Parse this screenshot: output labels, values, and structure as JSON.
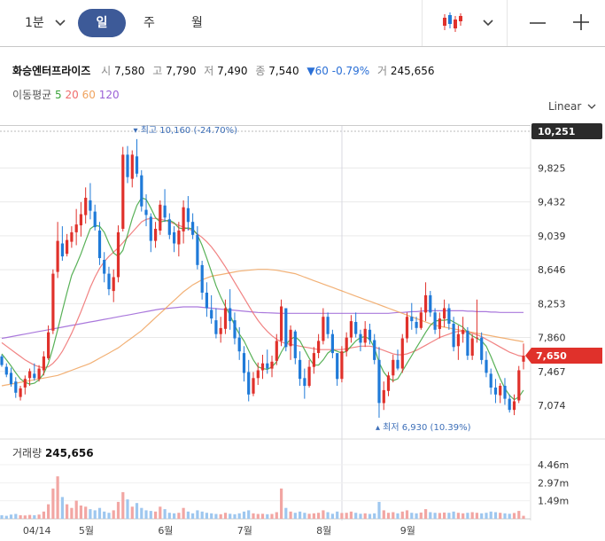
{
  "toolbar": {
    "interval": "1분",
    "tabs": [
      "일",
      "주",
      "월"
    ],
    "active_tab": "일"
  },
  "stock": {
    "name": "화승엔터프라이즈",
    "open_label": "시",
    "open": "7,580",
    "high_label": "고",
    "high": "7,790",
    "low_label": "저",
    "low": "7,490",
    "close_label": "종",
    "close": "7,540",
    "change": "▼60",
    "change_pct": "-0.79%",
    "volume_label": "거",
    "volume": "245,656"
  },
  "ma_legend": {
    "label": "이동평균",
    "periods": [
      "5",
      "20",
      "60",
      "120"
    ]
  },
  "scale_mode": "Linear",
  "volume_panel": {
    "label": "거래량",
    "value": "245,656"
  },
  "colors": {
    "up": "#e0312b",
    "down": "#1f7ad8",
    "ma5": "#3ba33a",
    "ma20": "#ef6c6c",
    "ma60": "#f0a35e",
    "ma120": "#9b61d6",
    "accent": "#3d5a98"
  },
  "chart_data": {
    "type": "candlestick",
    "y_ticks": [
      "9,825",
      "9,432",
      "9,039",
      "8,646",
      "8,253",
      "7,860",
      "7,467",
      "7,074"
    ],
    "y_tick_values": [
      9825,
      9432,
      9039,
      8646,
      8253,
      7860,
      7467,
      7074
    ],
    "x_labels": [
      "04/14",
      "5월",
      "6월",
      "7월",
      "8월",
      "9월"
    ],
    "high_marker": {
      "label": "최고",
      "value": "10,160",
      "pct": "(-24.70%)",
      "price": 10160
    },
    "low_marker": {
      "label": "최저",
      "value": "6,930",
      "pct": "(10.39%)",
      "price": 6930
    },
    "top_badge": "10,251",
    "top_badge_value": 10251,
    "last_badge": "7,650",
    "last_value": 7650,
    "volume_ticks": [
      "4.46m",
      "2.97m",
      "1.49m"
    ],
    "volume_tick_values": [
      4460000,
      2970000,
      1490000
    ],
    "candles": [
      [
        7660,
        7520,
        7640,
        7540,
        -1
      ],
      [
        7560,
        7400,
        7520,
        7430,
        -1
      ],
      [
        7510,
        7290,
        7450,
        7320,
        -1
      ],
      [
        7400,
        7160,
        7350,
        7220,
        -1
      ],
      [
        7300,
        7130,
        7170,
        7270,
        1
      ],
      [
        7420,
        7200,
        7280,
        7380,
        1
      ],
      [
        7500,
        7300,
        7390,
        7470,
        1
      ],
      [
        7560,
        7360,
        7440,
        7390,
        -1
      ],
      [
        7540,
        7350,
        7380,
        7500,
        1
      ],
      [
        7700,
        7420,
        7480,
        7640,
        1
      ],
      [
        8000,
        7600,
        7620,
        7920,
        1
      ],
      [
        8650,
        7900,
        7940,
        8600,
        1
      ],
      [
        9200,
        8550,
        8620,
        8980,
        1
      ],
      [
        9150,
        8750,
        8950,
        8800,
        -1
      ],
      [
        9060,
        8800,
        8830,
        8990,
        1
      ],
      [
        9150,
        8900,
        8970,
        9080,
        1
      ],
      [
        9350,
        8930,
        9080,
        9170,
        1
      ],
      [
        9430,
        9030,
        9160,
        9290,
        1
      ],
      [
        9600,
        9180,
        9280,
        9480,
        1
      ],
      [
        9650,
        9230,
        9450,
        9330,
        -1
      ],
      [
        9400,
        9100,
        9320,
        9140,
        -1
      ],
      [
        9200,
        8700,
        9100,
        8780,
        -1
      ],
      [
        8850,
        8500,
        8760,
        8600,
        -1
      ],
      [
        8680,
        8350,
        8600,
        8420,
        -1
      ],
      [
        8650,
        8270,
        8400,
        8560,
        1
      ],
      [
        9160,
        8500,
        8560,
        9080,
        1
      ],
      [
        10070,
        9090,
        9120,
        9980,
        1
      ],
      [
        10080,
        9650,
        9980,
        9720,
        -1
      ],
      [
        10030,
        9600,
        9700,
        9980,
        1
      ],
      [
        10160,
        9720,
        9960,
        9760,
        -1
      ],
      [
        9800,
        9320,
        9740,
        9380,
        -1
      ],
      [
        9520,
        9150,
        9340,
        9280,
        -1
      ],
      [
        9300,
        8850,
        9260,
        8980,
        -1
      ],
      [
        9200,
        8900,
        8980,
        9120,
        1
      ],
      [
        9450,
        9050,
        9100,
        9400,
        1
      ],
      [
        9580,
        9200,
        9390,
        9250,
        -1
      ],
      [
        9300,
        9000,
        9230,
        9050,
        -1
      ],
      [
        9150,
        8850,
        9080,
        8950,
        -1
      ],
      [
        9200,
        8800,
        8940,
        9100,
        1
      ],
      [
        9450,
        8950,
        9090,
        9370,
        1
      ],
      [
        9500,
        9100,
        9360,
        9200,
        -1
      ],
      [
        9300,
        9000,
        9200,
        9050,
        -1
      ],
      [
        9150,
        8650,
        9050,
        8700,
        -1
      ],
      [
        8750,
        8300,
        8700,
        8380,
        -1
      ],
      [
        8500,
        8100,
        8380,
        8200,
        -1
      ],
      [
        8350,
        8020,
        8180,
        8080,
        -1
      ],
      [
        8200,
        7850,
        8060,
        7900,
        -1
      ],
      [
        8100,
        7800,
        7900,
        7970,
        1
      ],
      [
        8300,
        7900,
        7960,
        8200,
        1
      ],
      [
        8420,
        7950,
        8200,
        8050,
        -1
      ],
      [
        8150,
        7780,
        8060,
        7850,
        -1
      ],
      [
        7980,
        7600,
        7860,
        7700,
        -1
      ],
      [
        7760,
        7350,
        7680,
        7450,
        -1
      ],
      [
        7600,
        7120,
        7460,
        7200,
        -1
      ],
      [
        7460,
        7180,
        7210,
        7390,
        1
      ],
      [
        7570,
        7310,
        7390,
        7480,
        1
      ],
      [
        7660,
        7380,
        7480,
        7560,
        1
      ],
      [
        7720,
        7440,
        7560,
        7500,
        -1
      ],
      [
        7650,
        7400,
        7500,
        7580,
        1
      ],
      [
        7900,
        7540,
        7590,
        7820,
        1
      ],
      [
        8300,
        7760,
        7820,
        8220,
        1
      ],
      [
        8150,
        7700,
        8200,
        7750,
        -1
      ],
      [
        8000,
        7600,
        7760,
        7950,
        1
      ],
      [
        7950,
        7550,
        7930,
        7620,
        -1
      ],
      [
        7700,
        7300,
        7600,
        7380,
        -1
      ],
      [
        7500,
        7150,
        7390,
        7300,
        -1
      ],
      [
        7600,
        7280,
        7300,
        7520,
        1
      ],
      [
        7750,
        7440,
        7520,
        7680,
        1
      ],
      [
        7900,
        7620,
        7680,
        7820,
        1
      ],
      [
        8200,
        7780,
        7820,
        8100,
        1
      ],
      [
        8150,
        7850,
        8100,
        7900,
        -1
      ],
      [
        7950,
        7620,
        7900,
        7680,
        -1
      ],
      [
        7650,
        7300,
        7680,
        7380,
        -1
      ],
      [
        7760,
        7340,
        7380,
        7700,
        1
      ],
      [
        7920,
        7640,
        7700,
        7860,
        1
      ],
      [
        8120,
        7800,
        7860,
        8050,
        1
      ],
      [
        8150,
        7860,
        8040,
        7900,
        -1
      ],
      [
        7950,
        7700,
        7900,
        7800,
        -1
      ],
      [
        8050,
        7750,
        7800,
        7960,
        1
      ],
      [
        8020,
        7780,
        7950,
        7830,
        -1
      ],
      [
        7900,
        7550,
        7830,
        7600,
        -1
      ],
      [
        7750,
        6930,
        7600,
        7100,
        -1
      ],
      [
        7350,
        7020,
        7100,
        7250,
        1
      ],
      [
        7460,
        7180,
        7240,
        7420,
        1
      ],
      [
        7660,
        7340,
        7420,
        7600,
        1
      ],
      [
        7720,
        7480,
        7600,
        7500,
        -1
      ],
      [
        7900,
        7450,
        7500,
        7850,
        1
      ],
      [
        8150,
        7800,
        7850,
        8100,
        1
      ],
      [
        8260,
        7950,
        8100,
        8050,
        -1
      ],
      [
        8100,
        7900,
        8040,
        7970,
        -1
      ],
      [
        8210,
        7950,
        7970,
        8150,
        1
      ],
      [
        8500,
        8050,
        8150,
        8350,
        1
      ],
      [
        8400,
        8100,
        8350,
        8150,
        -1
      ],
      [
        8200,
        7900,
        8150,
        7950,
        -1
      ],
      [
        8150,
        7850,
        7960,
        8080,
        1
      ],
      [
        8300,
        7980,
        8080,
        8200,
        1
      ],
      [
        8250,
        7950,
        8200,
        8020,
        -1
      ],
      [
        8100,
        7700,
        8020,
        7750,
        -1
      ],
      [
        8000,
        7600,
        7760,
        7900,
        1
      ],
      [
        8100,
        7800,
        7900,
        7950,
        1
      ],
      [
        7980,
        7600,
        7940,
        7650,
        -1
      ],
      [
        7900,
        7600,
        7650,
        7850,
        1
      ],
      [
        8300,
        7800,
        7850,
        7860,
        1
      ],
      [
        7920,
        7550,
        7860,
        7600,
        -1
      ],
      [
        7700,
        7400,
        7600,
        7450,
        -1
      ],
      [
        7500,
        7200,
        7440,
        7280,
        -1
      ],
      [
        7380,
        7100,
        7280,
        7200,
        -1
      ],
      [
        7330,
        7100,
        7190,
        7300,
        1
      ],
      [
        7390,
        7080,
        7300,
        7150,
        -1
      ],
      [
        7200,
        6990,
        7150,
        7020,
        -1
      ],
      [
        7200,
        6960,
        7020,
        7120,
        1
      ],
      [
        7530,
        7100,
        7130,
        7480,
        1
      ],
      [
        7790,
        7490,
        7580,
        7650,
        1
      ]
    ],
    "ma5": [
      7670,
      7600,
      7530,
      7450,
      7380,
      7340,
      7320,
      7330,
      7370,
      7440,
      7560,
      7740,
      7950,
      8170,
      8380,
      8580,
      8700,
      8830,
      8980,
      9120,
      9160,
      9150,
      9080,
      8950,
      8840,
      8800,
      8870,
      9050,
      9240,
      9390,
      9480,
      9460,
      9360,
      9250,
      9200,
      9210,
      9220,
      9190,
      9130,
      9120,
      9130,
      9120,
      9050,
      8930,
      8780,
      8620,
      8460,
      8330,
      8220,
      8120,
      8000,
      7900,
      7820,
      7710,
      7600,
      7520,
      7500,
      7490,
      7520,
      7580,
      7690,
      7780,
      7840,
      7870,
      7820,
      7720,
      7620,
      7540,
      7540,
      7600,
      7680,
      7720,
      7700,
      7680,
      7700,
      7760,
      7820,
      7860,
      7870,
      7840,
      7740,
      7570,
      7460,
      7390,
      7360,
      7380,
      7470,
      7560,
      7650,
      7740,
      7830,
      7920,
      8000,
      8050,
      8060,
      8060,
      8070,
      8040,
      8010,
      7980,
      7920,
      7880,
      7850,
      7820,
      7760,
      7640,
      7510,
      7380,
      7270,
      7190,
      7140,
      7170,
      7250
    ],
    "ma20": [
      7800,
      7760,
      7720,
      7680,
      7640,
      7600,
      7570,
      7540,
      7520,
      7510,
      7520,
      7560,
      7620,
      7700,
      7800,
      7910,
      8030,
      8160,
      8300,
      8440,
      8560,
      8660,
      8740,
      8800,
      8850,
      8900,
      8960,
      9020,
      9080,
      9140,
      9200,
      9230,
      9240,
      9240,
      9230,
      9220,
      9200,
      9180,
      9160,
      9140,
      9120,
      9100,
      9060,
      9020,
      8970,
      8910,
      8840,
      8760,
      8680,
      8590,
      8500,
      8410,
      8320,
      8230,
      8140,
      8060,
      7990,
      7930,
      7880,
      7840,
      7810,
      7790,
      7780,
      7770,
      7760,
      7750,
      7740,
      7730,
      7720,
      7720,
      7720,
      7720,
      7720,
      7720,
      7730,
      7740,
      7750,
      7760,
      7760,
      7760,
      7750,
      7730,
      7710,
      7690,
      7670,
      7660,
      7660,
      7670,
      7690,
      7710,
      7740,
      7770,
      7800,
      7830,
      7860,
      7880,
      7900,
      7920,
      7930,
      7930,
      7920,
      7910,
      7890,
      7870,
      7840,
      7810,
      7780,
      7750,
      7720,
      7690,
      7670,
      7650,
      7640
    ],
    "ma60": [
      7300,
      7310,
      7320,
      7330,
      7340,
      7350,
      7360,
      7370,
      7380,
      7390,
      7400,
      7410,
      7420,
      7440,
      7460,
      7480,
      7500,
      7520,
      7540,
      7560,
      7590,
      7620,
      7650,
      7680,
      7710,
      7740,
      7780,
      7820,
      7860,
      7900,
      7940,
      7990,
      8040,
      8090,
      8140,
      8190,
      8240,
      8290,
      8340,
      8390,
      8430,
      8470,
      8500,
      8530,
      8550,
      8570,
      8580,
      8590,
      8600,
      8610,
      8620,
      8630,
      8635,
      8640,
      8645,
      8650,
      8650,
      8650,
      8645,
      8640,
      8630,
      8620,
      8610,
      8600,
      8580,
      8560,
      8540,
      8520,
      8500,
      8480,
      8460,
      8440,
      8420,
      8400,
      8380,
      8360,
      8340,
      8320,
      8300,
      8280,
      8260,
      8240,
      8220,
      8200,
      8180,
      8160,
      8140,
      8120,
      8100,
      8080,
      8060,
      8040,
      8020,
      8000,
      7990,
      7980,
      7970,
      7960,
      7950,
      7940,
      7930,
      7920,
      7910,
      7900,
      7890,
      7880,
      7870,
      7860,
      7850,
      7840,
      7830,
      7820,
      7810
    ],
    "ma120": [
      7850,
      7860,
      7870,
      7880,
      7890,
      7900,
      7910,
      7920,
      7930,
      7940,
      7950,
      7960,
      7970,
      7980,
      7990,
      8000,
      8010,
      8020,
      8030,
      8040,
      8050,
      8060,
      8070,
      8080,
      8090,
      8100,
      8110,
      8120,
      8130,
      8140,
      8150,
      8160,
      8170,
      8180,
      8190,
      8195,
      8200,
      8205,
      8210,
      8215,
      8215,
      8215,
      8215,
      8210,
      8205,
      8200,
      8195,
      8190,
      8185,
      8180,
      8175,
      8170,
      8165,
      8160,
      8155,
      8150,
      8148,
      8146,
      8144,
      8142,
      8140,
      8140,
      8140,
      8140,
      8140,
      8140,
      8140,
      8140,
      8140,
      8140,
      8140,
      8140,
      8140,
      8140,
      8140,
      8140,
      8140,
      8140,
      8140,
      8140,
      8140,
      8140,
      8140,
      8140,
      8145,
      8150,
      8150,
      8155,
      8160,
      8160,
      8165,
      8170,
      8170,
      8170,
      8170,
      8170,
      8170,
      8170,
      8170,
      8170,
      8165,
      8165,
      8160,
      8160,
      8160,
      8155,
      8155,
      8150,
      8150,
      8150,
      8150,
      8150,
      8150
    ],
    "volume": [
      300000,
      250000,
      350000,
      400000,
      300000,
      280000,
      320000,
      300000,
      350000,
      600000,
      1200000,
      2500000,
      3500000,
      1800000,
      1200000,
      900000,
      1500000,
      1100000,
      1000000,
      800000,
      700000,
      900000,
      600000,
      500000,
      700000,
      1400000,
      2200000,
      1600000,
      1000000,
      1300000,
      900000,
      700000,
      650000,
      600000,
      1000000,
      800000,
      500000,
      450000,
      500000,
      900000,
      600000,
      450000,
      700000,
      600000,
      500000,
      450000,
      400000,
      380000,
      500000,
      420000,
      380000,
      450000,
      600000,
      700000,
      450000,
      400000,
      420000,
      380000,
      400000,
      550000,
      2500000,
      900000,
      600000,
      500000,
      600000,
      500000,
      420000,
      450000,
      500000,
      700000,
      550000,
      420000,
      600000,
      480000,
      500000,
      600000,
      500000,
      420000,
      450000,
      400000,
      450000,
      1400000,
      700000,
      500000,
      550000,
      450000,
      600000,
      700000,
      500000,
      450000,
      520000,
      800000,
      550000,
      500000,
      480000,
      520000,
      500000,
      600000,
      500000,
      450000,
      500000,
      550000,
      500000,
      450000,
      500000,
      600000,
      550000,
      500000,
      450000,
      420000,
      480000,
      650000,
      245656
    ]
  }
}
